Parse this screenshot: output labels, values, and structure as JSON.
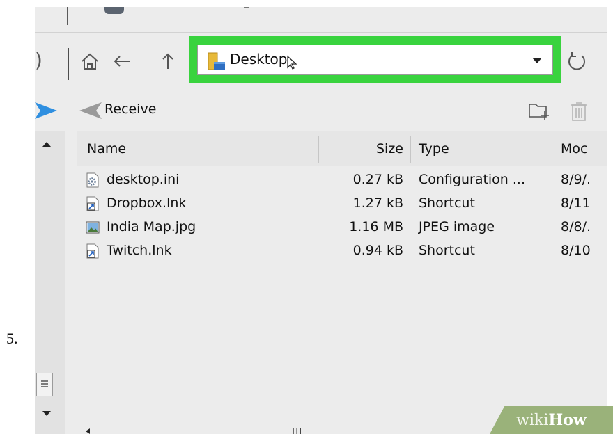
{
  "step": {
    "number": "5."
  },
  "toolbar": {
    "address": {
      "value": "Desktop",
      "icon": "folder-icon",
      "highlight_color": "#39d33e"
    },
    "home_icon": "home-icon",
    "back_icon": "arrow-left-icon",
    "up_icon": "arrow-up-icon",
    "refresh_icon": "refresh-icon",
    "dropdown_icon": "chevron-down-icon"
  },
  "actions": {
    "receive_label": "Receive",
    "send_icon": "send-arrow-icon",
    "receive_icon": "receive-arrow-icon",
    "new_folder_icon": "new-folder-icon",
    "delete_icon": "trash-icon"
  },
  "file_list": {
    "columns": {
      "name": "Name",
      "size": "Size",
      "type": "Type",
      "modified": "Moc"
    },
    "rows": [
      {
        "name": "desktop.ini",
        "size": "0.27 kB",
        "type": "Configuration ...",
        "modified": "8/9/.",
        "icon": "settings-file-icon"
      },
      {
        "name": "Dropbox.lnk",
        "size": "1.27 kB",
        "type": "Shortcut",
        "modified": "8/11",
        "icon": "shortcut-icon"
      },
      {
        "name": "India Map.jpg",
        "size": "1.16 MB",
        "type": "JPEG image",
        "modified": "8/8/.",
        "icon": "image-file-icon"
      },
      {
        "name": "Twitch.lnk",
        "size": "0.94 kB",
        "type": "Shortcut",
        "modified": "8/10",
        "icon": "shortcut-icon"
      }
    ],
    "scroll_grip": "III"
  },
  "watermark": {
    "wiki": "wiki",
    "how": "How"
  },
  "colors": {
    "send_arrow": "#2f8fe0",
    "receive_arrow": "#9a9a9a",
    "panel_bg": "#ececec"
  }
}
